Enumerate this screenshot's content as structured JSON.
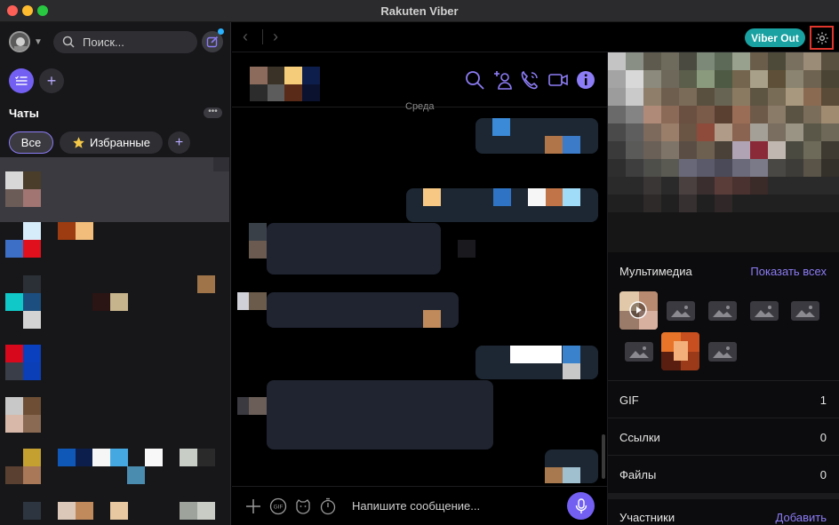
{
  "window": {
    "title": "Rakuten Viber"
  },
  "sidebar": {
    "search_placeholder": "Поиск...",
    "chats_title": "Чаты",
    "more_label": "•••",
    "tabs": [
      {
        "label": "Все"
      },
      {
        "label": "Избранные",
        "icon": "star-icon"
      }
    ],
    "add_folder_label": "+",
    "add_tab_label": "+"
  },
  "topbar": {
    "back_label": "‹",
    "forward_label": "›",
    "viber_out_label": "Viber Out"
  },
  "conversation": {
    "day_label": "Среда",
    "composer_placeholder": "Напишите сообщение...",
    "header_icons": [
      "search-icon",
      "add-participant-icon",
      "call-icon",
      "video-call-icon",
      "info-icon"
    ],
    "composer_icons": [
      "plus-icon",
      "gif-icon",
      "sticker-icon",
      "timer-icon",
      "mic-icon"
    ]
  },
  "info_panel": {
    "media_title": "Мультимедиа",
    "show_all": "Показать всех",
    "gif_label": "GIF",
    "gif_count": "1",
    "links_label": "Ссылки",
    "links_count": "0",
    "files_label": "Файлы",
    "files_count": "0",
    "participants_label": "Участники",
    "add_label": "Добавить"
  },
  "colors": {
    "accent": "#7360f2",
    "viber_out": "#1aa1a1",
    "highlight_border": "#e0362c",
    "notification_dot": "#2ab2ff"
  }
}
